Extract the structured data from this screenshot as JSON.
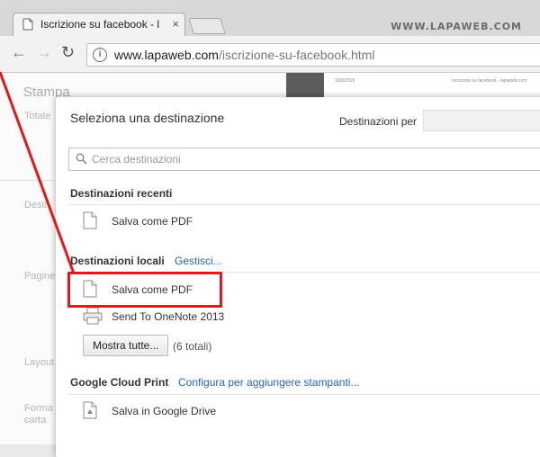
{
  "browser": {
    "tab_title": "Iscrizione su facebook - l",
    "tab_close": "×",
    "watermark": "WWW.LAPAWEB.COM",
    "url_host": "www.lapaweb.com",
    "url_path": "/iscrizione-su-facebook.html",
    "info_icon": "i"
  },
  "background": {
    "title": "Stampa",
    "labels": [
      "Totale",
      "Desti",
      "Pagine",
      "Layout",
      "Forma",
      "carta"
    ],
    "preview_header_left": "19/8/2015",
    "preview_header_right": "Iscrizione su facebook - lapaweb.com"
  },
  "dialog": {
    "title": "Seleziona una destinazione",
    "destinations_for_label": "Destinazioni per",
    "search_placeholder": "Cerca destinazioni",
    "recent_heading": "Destinazioni recenti",
    "recent_items": [
      {
        "label": "Salva come PDF",
        "icon": "document-icon"
      }
    ],
    "local_heading": "Destinazioni locali",
    "local_manage_link": "Gestisci...",
    "local_items": [
      {
        "label": "Salva come PDF",
        "icon": "document-icon"
      },
      {
        "label": "Send To OneNote 2013",
        "icon": "printer-icon"
      }
    ],
    "show_all_button": "Mostra tutte...",
    "total_count": "(6 totali)",
    "cloud_heading": "Google Cloud Print",
    "cloud_configure_link": "Configura per aggiungere stampanti...",
    "cloud_items": [
      {
        "label": "Salva in Google Drive",
        "icon": "google-drive-icon"
      }
    ]
  },
  "colors": {
    "annotation_red": "#e8161a",
    "link_blue": "#2a62c9"
  }
}
